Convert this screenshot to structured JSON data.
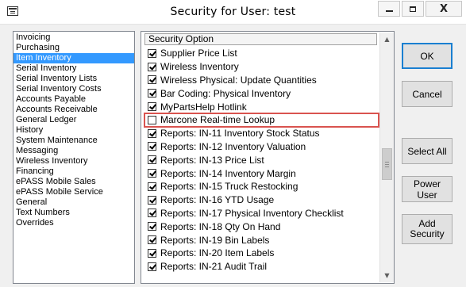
{
  "window": {
    "title": "Security for User: test",
    "min_glyph": "minimize-icon",
    "max_glyph": "maximize-icon",
    "close_label": "X"
  },
  "categories": {
    "selected_index": 2,
    "items": [
      "Invoicing",
      "Purchasing",
      "Item Inventory",
      "Serial Inventory",
      "Serial Inventory Lists",
      "Serial Inventory Costs",
      "Accounts Payable",
      "Accounts Receivable",
      "General Ledger",
      "History",
      "System Maintenance",
      "Messaging",
      "Wireless Inventory",
      "Financing",
      "ePASS Mobile Sales",
      "ePASS Mobile Service",
      "General",
      "Text Numbers",
      "Overrides"
    ]
  },
  "options": {
    "header": "Security Option",
    "rows": [
      {
        "label": "Supplier Price List",
        "checked": true
      },
      {
        "label": "Wireless Inventory",
        "checked": true
      },
      {
        "label": "Wireless Physical: Update Quantities",
        "checked": true
      },
      {
        "label": "Bar Coding: Physical Inventory",
        "checked": true
      },
      {
        "label": "MyPartsHelp Hotlink",
        "checked": true
      },
      {
        "label": "Marcone Real-time Lookup",
        "checked": false,
        "highlighted": true
      },
      {
        "label": "Reports: IN-11 Inventory Stock Status",
        "checked": true
      },
      {
        "label": "Reports: IN-12 Inventory Valuation",
        "checked": true
      },
      {
        "label": "Reports: IN-13 Price List",
        "checked": true
      },
      {
        "label": "Reports: IN-14 Inventory Margin",
        "checked": true
      },
      {
        "label": "Reports: IN-15 Truck Restocking",
        "checked": true
      },
      {
        "label": "Reports: IN-16 YTD Usage",
        "checked": true
      },
      {
        "label": "Reports: IN-17 Physical Inventory Checklist",
        "checked": true
      },
      {
        "label": "Reports: IN-18 Qty On Hand",
        "checked": true
      },
      {
        "label": "Reports: IN-19 Bin Labels",
        "checked": true
      },
      {
        "label": "Reports: IN-20 Item Labels",
        "checked": true
      },
      {
        "label": "Reports: IN-21 Audit Trail",
        "checked": true
      }
    ]
  },
  "buttons": {
    "ok": "OK",
    "cancel": "Cancel",
    "select_all": "Select All",
    "power_user": "Power User",
    "add_security": "Add Security"
  },
  "colors": {
    "selection": "#3399ff",
    "highlight_outline": "#d9534f",
    "default_button_border": "#1a7fd1"
  }
}
